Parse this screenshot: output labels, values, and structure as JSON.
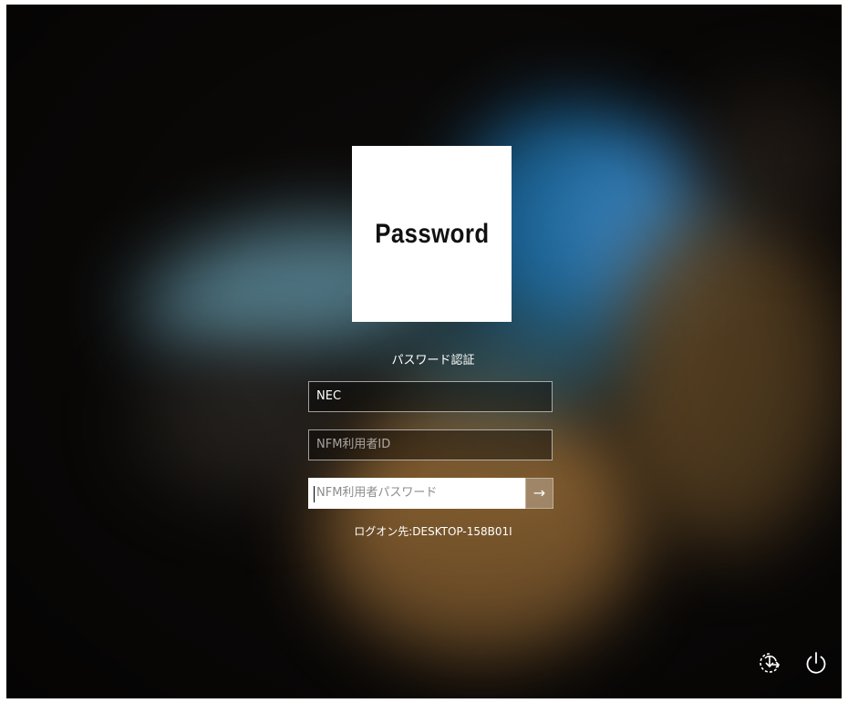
{
  "tile": {
    "text": "Password"
  },
  "provider_title": "パスワード認証",
  "fields": {
    "domain": {
      "value": "NEC"
    },
    "user_id": {
      "placeholder": "NFM利用者ID"
    },
    "password": {
      "placeholder": "NFM利用者パスワード"
    }
  },
  "submit": {
    "icon": "arrow-right-icon",
    "glyph": "→"
  },
  "logon_target": "ログオン先:DESKTOP-158B01I",
  "corner_buttons": [
    {
      "name": "ease-of-access",
      "icon": "ease-of-access-icon"
    },
    {
      "name": "power",
      "icon": "power-icon"
    }
  ],
  "colors": {
    "text": "#ffffff",
    "tile_background": "#ffffff",
    "field_border": "#ffffff"
  }
}
